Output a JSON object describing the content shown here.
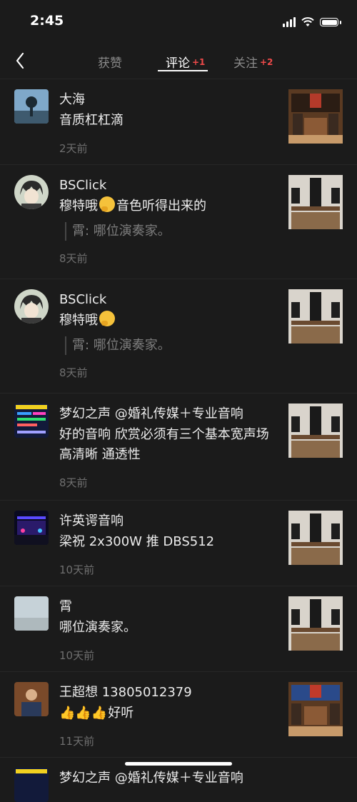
{
  "status": {
    "time": "2:45"
  },
  "tabs": [
    {
      "label": "获赞",
      "badge": ""
    },
    {
      "label": "评论",
      "badge": "+1"
    },
    {
      "label": "关注",
      "badge": "+2"
    }
  ],
  "comments": [
    {
      "name": "大海",
      "text": "音质杠杠滴",
      "quote": "",
      "time": "2天前"
    },
    {
      "name": "BSClick",
      "text_before": "穆特哦",
      "text_after": "音色听得出来的",
      "quote": "霄: 哪位演奏家。",
      "time": "8天前"
    },
    {
      "name": "BSClick",
      "text_before": "穆特哦",
      "text_after": "",
      "quote": "霄: 哪位演奏家。",
      "time": "8天前"
    },
    {
      "name": "梦幻之声 @婚礼传媒＋专业音响",
      "text": "好的音响 欣赏必须有三个基本宽声场 高清晰 通透性",
      "quote": "",
      "time": "8天前"
    },
    {
      "name": "许英谔音响",
      "text": "梁祝 2x300W 推 DBS512",
      "quote": "",
      "time": "10天前"
    },
    {
      "name": "霄",
      "text": "哪位演奏家。",
      "quote": "",
      "time": "10天前"
    },
    {
      "name": "王超想 13805012379",
      "thumbs": "👍👍👍",
      "text": "好听",
      "quote": "",
      "time": "11天前"
    },
    {
      "name": "梦幻之声 @婚礼传媒＋专业音响"
    }
  ]
}
